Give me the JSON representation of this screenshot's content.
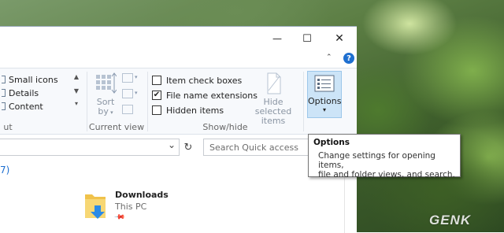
{
  "window": {
    "controls": {
      "minimize": "—",
      "maximize": "☐",
      "close": "✕"
    },
    "ribbon_top": {
      "help_icon": "?"
    }
  },
  "ribbon": {
    "layout": {
      "items": [
        "Small icons",
        "Details",
        "Content"
      ],
      "group_label": "ut"
    },
    "current_view": {
      "sort_label": "Sort",
      "sort_sub": "by",
      "group_label": "Current view"
    },
    "show_hide": {
      "item_check_boxes": {
        "label": "Item check boxes",
        "checked": false
      },
      "file_name_extensions": {
        "label": "File name extensions",
        "checked": true
      },
      "hidden_items": {
        "label": "Hidden items",
        "checked": false
      },
      "hide_selected_line1": "Hide selected",
      "hide_selected_line2": "items",
      "group_label": "Show/hide"
    },
    "options": {
      "label": "Options",
      "arrow": "▾"
    }
  },
  "address": {
    "search_placeholder": "Search Quick access",
    "refresh_icon": "↻",
    "dropdown_icon": "⌄"
  },
  "content": {
    "group_header": "7)",
    "item": {
      "name": "Downloads",
      "location": "This PC"
    }
  },
  "tooltip": {
    "title": "Options",
    "line1": "Change settings for opening items,",
    "line2": "file and folder views, and search."
  },
  "watermark": "GENK",
  "colors": {
    "accent": "#1e6fd0",
    "ribbon_bg": "#f7f9fc",
    "options_highlight": "#cce4f7",
    "folder_yellow": "#f0c24b",
    "download_blue": "#2b8ae6"
  }
}
